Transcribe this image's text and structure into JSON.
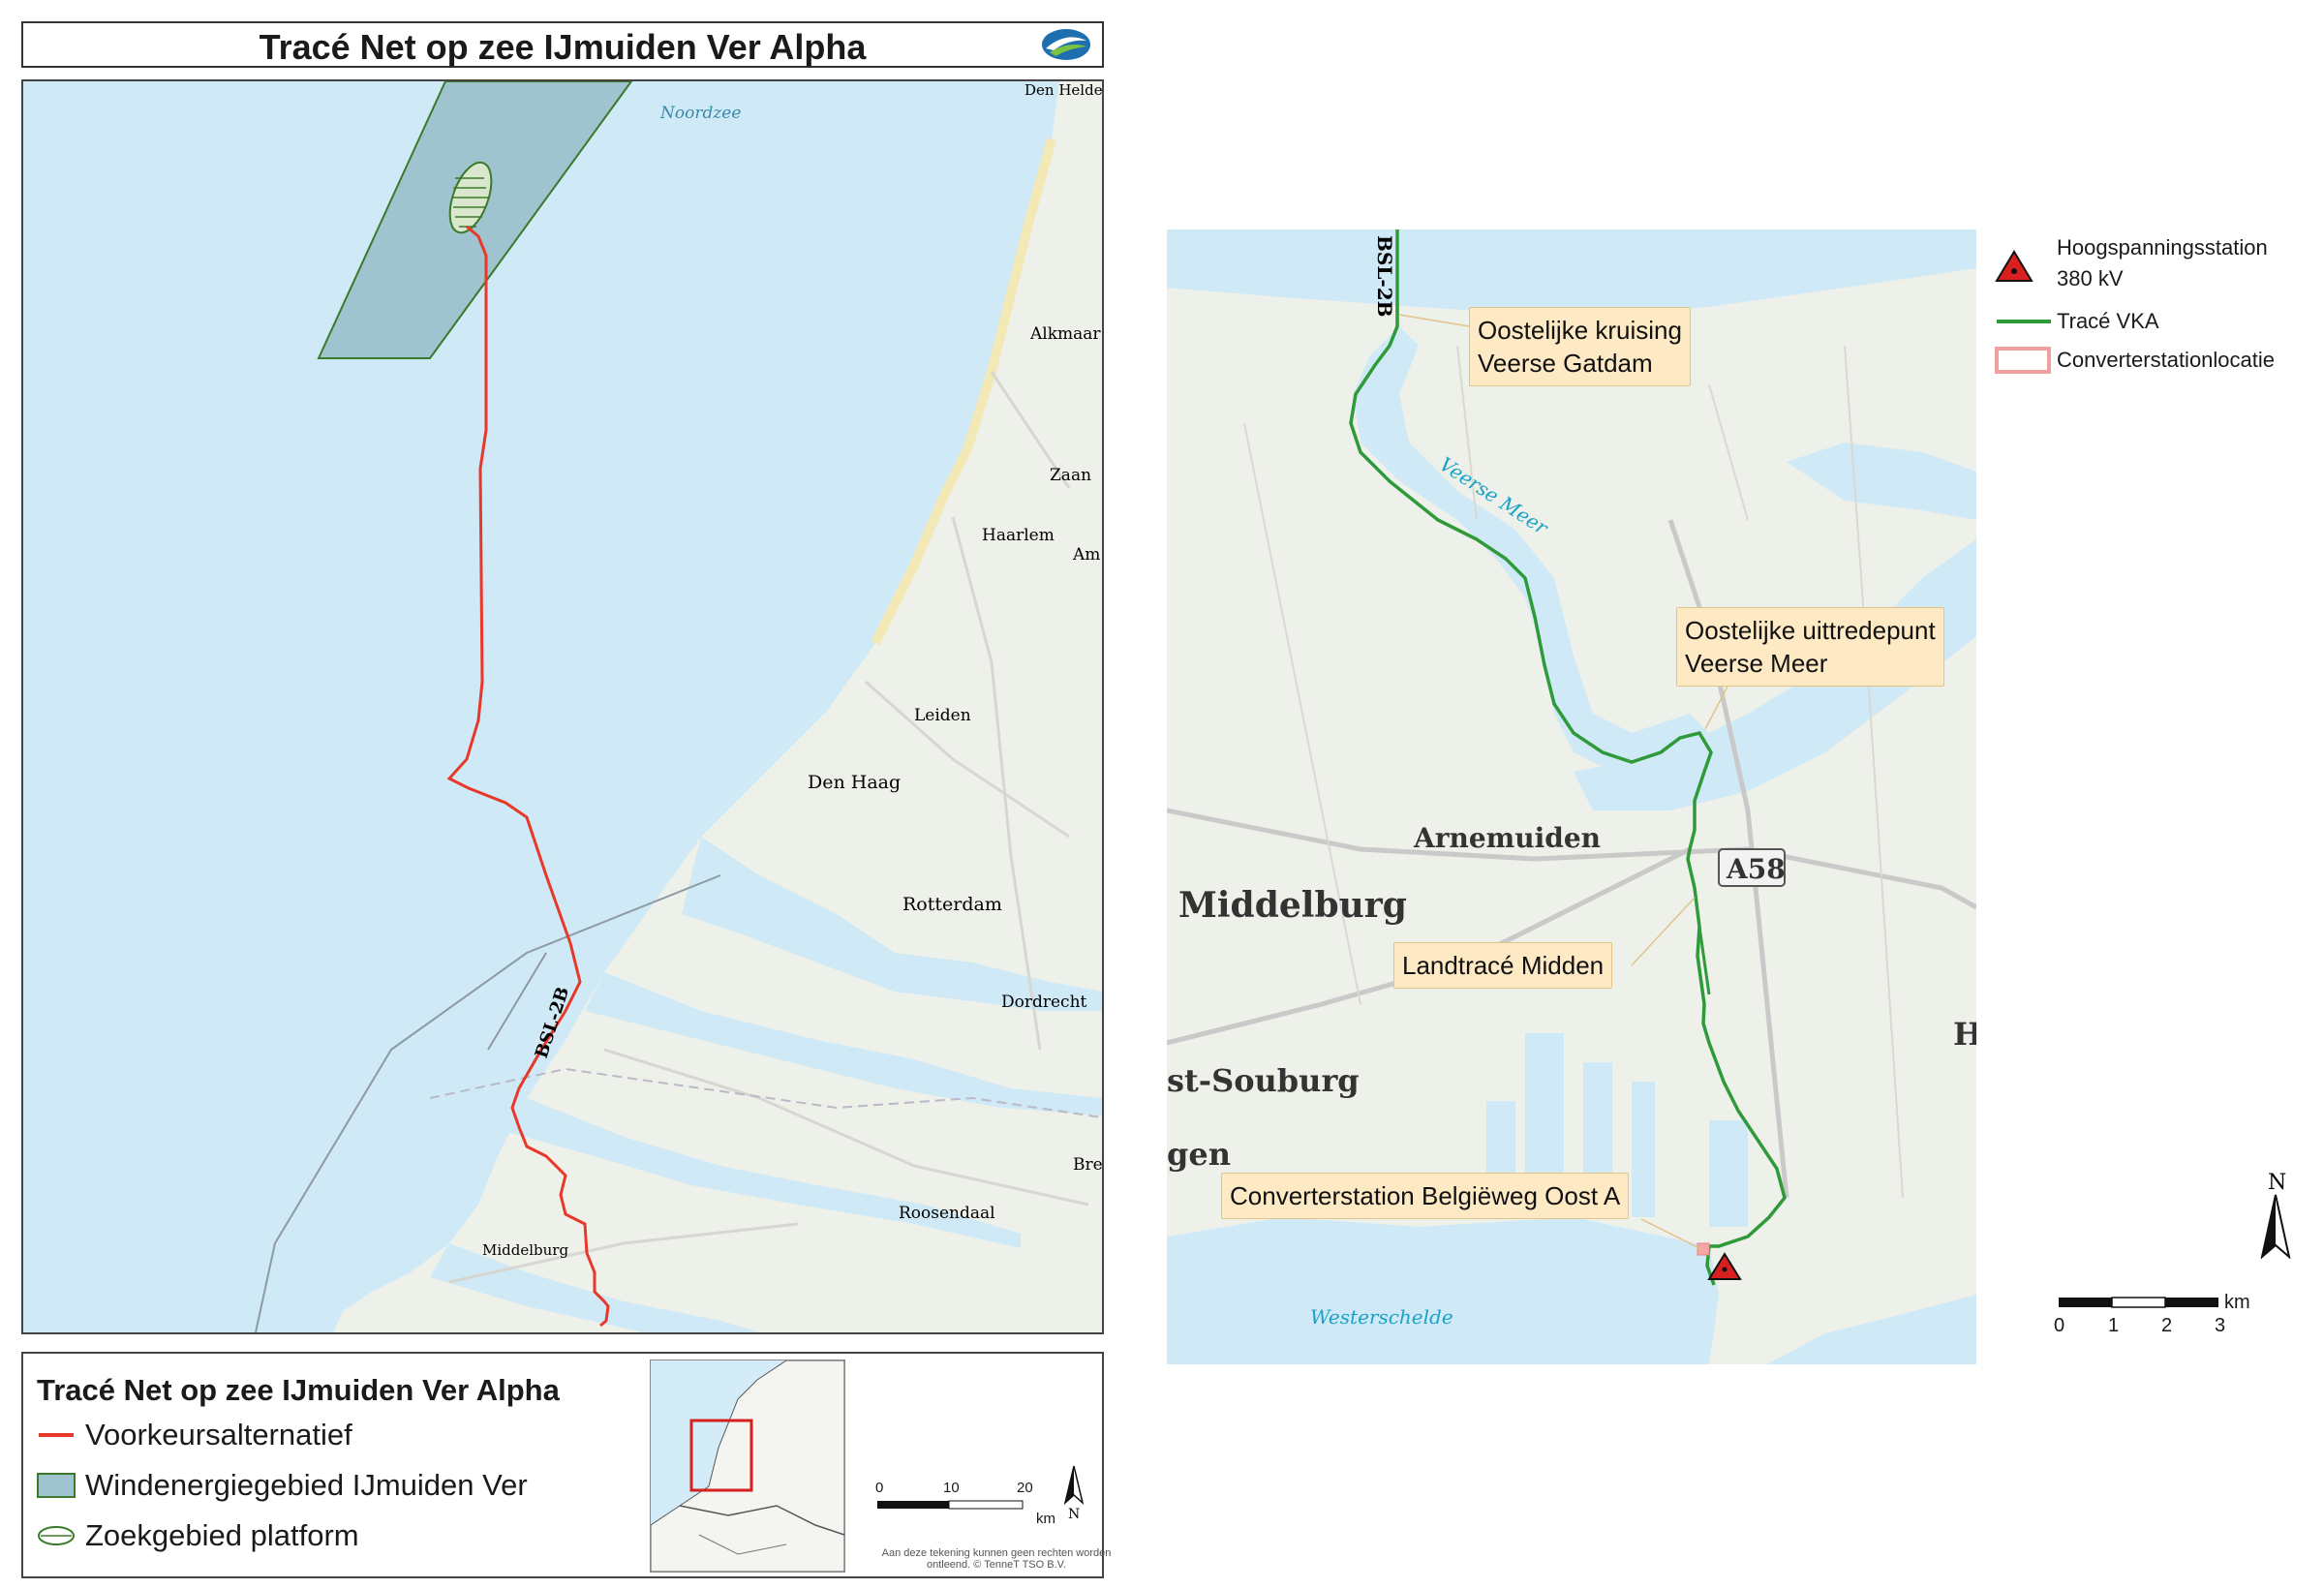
{
  "title": "Tracé Net op zee IJmuiden Ver Alpha",
  "left_map": {
    "sea_label": "Noordzee",
    "route_label": "BSL-2B",
    "places": [
      {
        "id": "den-helder",
        "name": "Den Helder"
      },
      {
        "id": "alkmaar",
        "name": "Alkmaar"
      },
      {
        "id": "zaandam",
        "name": "Zaan"
      },
      {
        "id": "haarlem",
        "name": "Haarlem"
      },
      {
        "id": "amsterdam",
        "name": "Am"
      },
      {
        "id": "leiden",
        "name": "Leiden"
      },
      {
        "id": "den-haag",
        "name": "Den Haag"
      },
      {
        "id": "rotterdam",
        "name": "Rotterdam"
      },
      {
        "id": "dordrecht",
        "name": "Dordrecht"
      },
      {
        "id": "breda",
        "name": "Bre"
      },
      {
        "id": "roosendaal",
        "name": "Roosendaal"
      },
      {
        "id": "middelburg",
        "name": "Middelburg"
      }
    ]
  },
  "legend_left": {
    "title": "Tracé Net op zee IJmuiden Ver Alpha",
    "items": [
      {
        "label": "Voorkeursalternatief",
        "color": "#e8382a"
      },
      {
        "label": "Windenergiegebied IJmuiden Ver",
        "color": "#9fc4cf"
      },
      {
        "label": "Zoekgebied platform",
        "color": "#3a7a2a"
      }
    ],
    "scale": {
      "t0": "0",
      "t1": "10",
      "t2": "20",
      "unit": "km"
    },
    "north": "N",
    "disclaimer": "Aan deze tekening kunnen geen rechten worden ontleend. © TenneT TSO B.V."
  },
  "right_map": {
    "route_label": "BSL-2B",
    "water_labels": {
      "veerse_meer": "Veerse Meer",
      "westerschelde": "Westerschelde"
    },
    "places": {
      "arnemuiden": "Arnemuiden",
      "middelburg": "Middelburg",
      "souburg": "st-Souburg",
      "vlissingen": "gen",
      "h": "H"
    },
    "road_shield": "A58",
    "callouts": [
      {
        "id": "gatdam",
        "line1": "Oostelijke kruising",
        "line2": "Veerse Gatdam"
      },
      {
        "id": "uittredepunt",
        "line1": "Oostelijke uittredepunt",
        "line2": "Veerse Meer"
      },
      {
        "id": "landtrace",
        "line1": "Landtracé Midden",
        "line2": ""
      },
      {
        "id": "converter",
        "line1": "Converterstation Belgiëweg Oost A",
        "line2": ""
      }
    ]
  },
  "legend_right": {
    "items": [
      {
        "line1": "Hoogspanningsstation",
        "line2": "380 kV"
      },
      {
        "line1": "Tracé VKA",
        "line2": ""
      },
      {
        "line1": "Converterstationlocatie",
        "line2": ""
      }
    ],
    "north": "N",
    "scale": {
      "t0": "0",
      "t1": "1",
      "t2": "2",
      "t3": "3",
      "unit": "km"
    },
    "colors": {
      "route": "#2e9a3a",
      "converter": "#f0a0a0",
      "station": "#d92020"
    }
  }
}
